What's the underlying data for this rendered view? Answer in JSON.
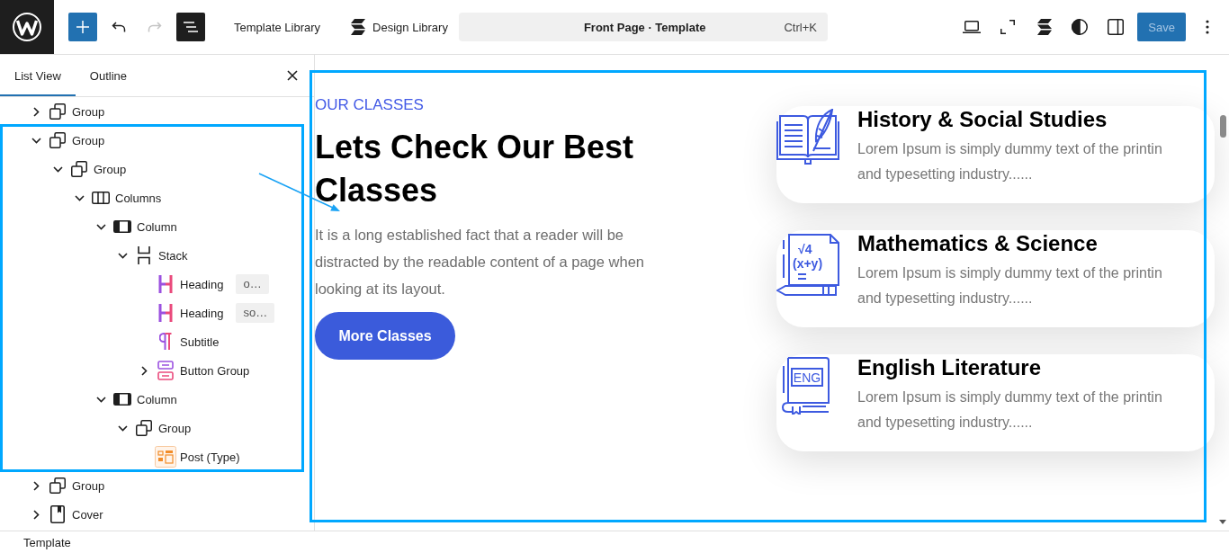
{
  "top_bar": {
    "history": [
      {
        "kind": "undo",
        "disabled": false
      },
      {
        "kind": "redo",
        "disabled": true
      }
    ],
    "document_overview": {
      "pressed": true
    },
    "libraries": [
      {
        "kind": "plain",
        "label": "Template Library"
      },
      {
        "kind": "with-icon",
        "label": "Design Library"
      }
    ],
    "command_center": {
      "title": "Front Page · Template",
      "shortcut": "Ctrl+K"
    },
    "view_tools": [
      {
        "kind": "device-preview"
      },
      {
        "kind": "fullscreen"
      },
      {
        "kind": "layers"
      },
      {
        "kind": "styles"
      },
      {
        "kind": "settings"
      }
    ],
    "save": {
      "label": "Save",
      "disabled": true
    }
  },
  "sidebar": {
    "tabs": [
      {
        "label": "List View",
        "selected": true
      },
      {
        "label": "Outline",
        "selected": false
      }
    ],
    "tree": [
      {
        "kind": "group",
        "label": "Group",
        "expanded": false
      },
      {
        "kind": "group",
        "label": "Group",
        "expanded": true,
        "children": [
          {
            "kind": "group",
            "label": "Group",
            "expanded": true,
            "children": [
              {
                "kind": "columns",
                "label": "Columns",
                "expanded": true,
                "children": [
                  {
                    "kind": "column",
                    "label": "Column",
                    "expanded": true,
                    "children": [
                      {
                        "kind": "stack",
                        "label": "Stack",
                        "expanded": true,
                        "children": [
                          {
                            "kind": "heading",
                            "label": "Heading",
                            "preview": "o…"
                          },
                          {
                            "kind": "heading",
                            "label": "Heading",
                            "preview": "so…"
                          },
                          {
                            "kind": "paragraph",
                            "label": "Subtitle"
                          },
                          {
                            "kind": "buttons",
                            "label": "Button Group",
                            "expanded": false
                          }
                        ]
                      }
                    ]
                  },
                  {
                    "kind": "column",
                    "label": "Column",
                    "expanded": true,
                    "children": [
                      {
                        "kind": "group",
                        "label": "Group",
                        "expanded": true,
                        "children": [
                          {
                            "kind": "post",
                            "label": "Post (Type)"
                          }
                        ]
                      }
                    ]
                  }
                ]
              }
            ]
          }
        ]
      },
      {
        "kind": "group",
        "label": "Group",
        "expanded": false
      },
      {
        "kind": "cover",
        "label": "Cover",
        "expanded": false
      }
    ]
  },
  "canvas": {
    "eyebrow": "OUR CLASSES",
    "heading": "Lets Check Our Best Classes",
    "text": "It is a long established fact that a reader will be distracted by the readable content of a page when looking at its layout.",
    "button": "More Classes",
    "cards": [
      {
        "kind": "open-book",
        "title": "History & Social Studies",
        "text": "Lorem Ipsum is simply dummy text of the printin\nand typesetting industry......"
      },
      {
        "kind": "math-notebook",
        "title": "Mathematics & Science",
        "icon_text": [
          "√4",
          "(x+y)"
        ],
        "text": "Lorem Ipsum is simply dummy text of the printin\nand typesetting industry......"
      },
      {
        "kind": "label-book",
        "title": "English Literature",
        "icon_text": [
          "ENG"
        ],
        "text": "Lorem Ipsum is simply dummy text of the printin\nand typesetting industry......"
      }
    ]
  },
  "status_bar": {
    "breadcrumb": "Template"
  }
}
